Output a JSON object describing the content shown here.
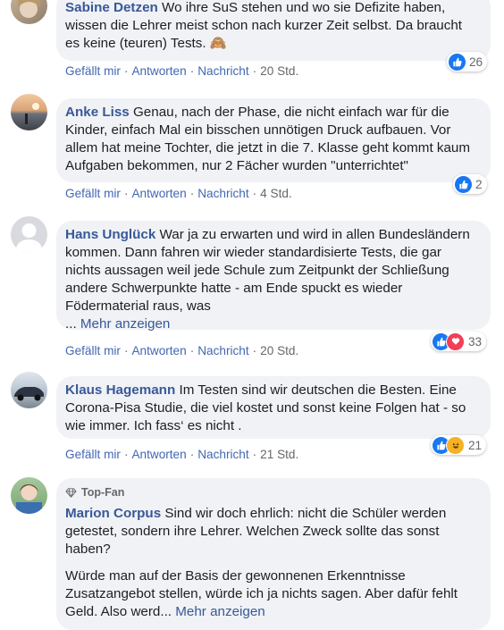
{
  "actions": {
    "like": "Gefällt mir",
    "reply": "Antworten",
    "message": "Nachricht"
  },
  "comments": [
    {
      "author": "Sabine Detzen",
      "text": "Wo ihre SuS stehen und wo sie Defizite haben, wissen die Lehrer meist schon nach kurzer Zeit selbst. Da braucht es keine (teuren) Tests.",
      "emoji": "🙈",
      "time": "20 Std.",
      "reaction_count": "26"
    },
    {
      "author": "Anke Liss",
      "text": "Genau, nach der Phase, die nicht einfach war für die Kinder, einfach Mal ein bisschen unnötigen Druck aufbauen. Vor allem hat meine Tochter, die jetzt in die 7. Klasse geht kommt kaum Aufgaben bekommen, nur 2 Fächer wurden \"unterrichtet\"",
      "time": "4 Std.",
      "reaction_count": "2"
    },
    {
      "author": "Hans Unglück",
      "text": "War ja zu erwarten und wird in allen Bundesländern kommen. Dann fahren wir wieder standardisierte Tests, die gar nichts aussagen weil jede Schule zum Zeitpunkt der Schließung andere Schwerpunkte hatte - am Ende spuckt es wieder Födermaterial raus, was",
      "more_prefix": "...",
      "more": "Mehr anzeigen",
      "time": "20 Std.",
      "reaction_count": "33"
    },
    {
      "author": "Klaus Hagemann",
      "text": "Im Testen sind wir deutschen die Besten. Eine Corona-Pisa Studie, die viel kostet und sonst keine Folgen hat - so wie immer. Ich fass‘ es nicht .",
      "time": "21 Std.",
      "reaction_count": "21"
    },
    {
      "badge": "Top-Fan",
      "author": "Marion Corpus",
      "text": "Sind wir doch ehrlich: nicht die Schüler werden getestet, sondern ihre Lehrer. Welchen Zweck sollte das sonst haben?",
      "text2": "Würde man auf der Basis der gewonnenen Erkenntnisse Zusatzangebot stellen, würde ich ja nichts sagen. Aber dafür fehlt Geld. Also werd...",
      "more": "Mehr anzeigen"
    }
  ]
}
